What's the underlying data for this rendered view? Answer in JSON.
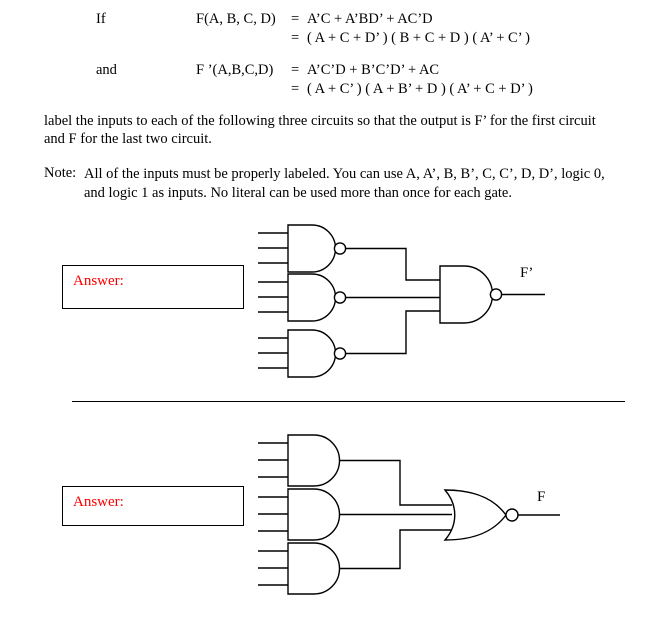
{
  "formula": {
    "if_label": "If",
    "and_label": "and",
    "f_name": "F(A, B, C, D)",
    "fprime_name": "F ’(A,B,C,D)",
    "eq_sign": "=",
    "f_sop": "A’C + A’BD’ + AC’D",
    "f_pos": "( A + C + D’ ) ( B + C + D ) ( A’ + C’ )",
    "fprime_sop": "A’C’D + B’C’D’ + AC",
    "fprime_pos": "( A + C’ ) ( A + B’ + D ) ( A’ + C + D’ )"
  },
  "prose": {
    "instruction_line1": "label the inputs to each of the following three circuits so that the output is F’ for the first circuit",
    "instruction_line2": "and F for the last two circuit.",
    "note_label": "Note:",
    "note_text": "All of the inputs must be properly labeled. You can use A, A’, B, B’, C, C’, D, D’, logic 0, and logic 1 as inputs. No literal can be used more than once for each gate."
  },
  "circuits": [
    {
      "id": "circuit-1",
      "answer_label": "Answer:",
      "output_label": "F’",
      "input_gate_type": "NAND",
      "input_gate_count": 3,
      "inputs_per_gate": 3,
      "output_gate_type": "NAND",
      "answer_text_color": "#ff0000"
    },
    {
      "id": "circuit-2",
      "answer_label": "Answer:",
      "output_label": "F",
      "input_gate_type": "AND",
      "input_gate_count": 3,
      "inputs_per_gate": 3,
      "output_gate_type": "NOR",
      "answer_text_color": "#ff0000"
    }
  ]
}
